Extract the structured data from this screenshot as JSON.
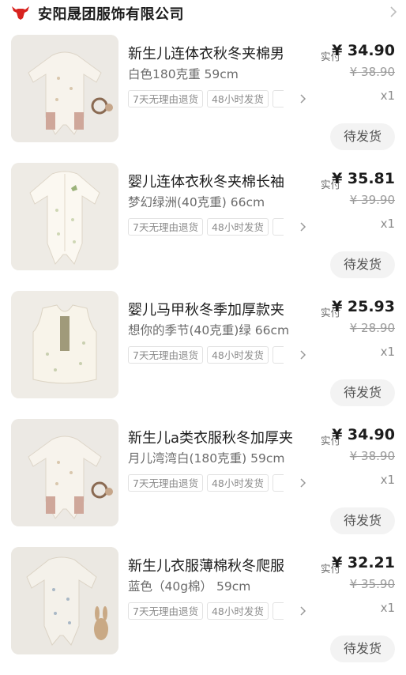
{
  "shop": {
    "name": "安阳晟团服饰有限公司",
    "logo_icon": "red-bull-logo-icon",
    "chevron_icon": "chevron-right-icon"
  },
  "labels": {
    "paid": "实付",
    "status": "待发货"
  },
  "orders": [
    {
      "title": "新生儿连体衣秋冬夹棉男",
      "spec": "白色180克重 59cm",
      "paid_price": "¥ 34.90",
      "original_price": "¥ 38.90",
      "quantity": "x1",
      "tags": [
        "7天无理由退货",
        "48小时发货"
      ]
    },
    {
      "title": "婴儿连体衣秋冬夹棉长袖",
      "spec": "梦幻绿洲(40克重) 66cm",
      "paid_price": "¥ 35.81",
      "original_price": "¥ 39.90",
      "quantity": "x1",
      "tags": [
        "7天无理由退货",
        "48小时发货"
      ]
    },
    {
      "title": "婴儿马甲秋冬季加厚款夹",
      "spec": "想你的季节(40克重)绿 66cm",
      "paid_price": "¥ 25.93",
      "original_price": "¥ 28.90",
      "quantity": "x1",
      "tags": [
        "7天无理由退货",
        "48小时发货"
      ]
    },
    {
      "title": "新生儿a类衣服秋冬加厚夹",
      "spec": "月儿湾湾白(180克重) 59cm",
      "paid_price": "¥ 34.90",
      "original_price": "¥ 38.90",
      "quantity": "x1",
      "tags": [
        "7天无理由退货",
        "48小时发货"
      ]
    },
    {
      "title": "新生儿衣服薄棉秋冬爬服",
      "spec": "蓝色（40g棉） 59cm",
      "paid_price": "¥ 32.21",
      "original_price": "¥ 35.90",
      "quantity": "x1",
      "tags": [
        "7天无理由退货",
        "48小时发货"
      ]
    }
  ]
}
